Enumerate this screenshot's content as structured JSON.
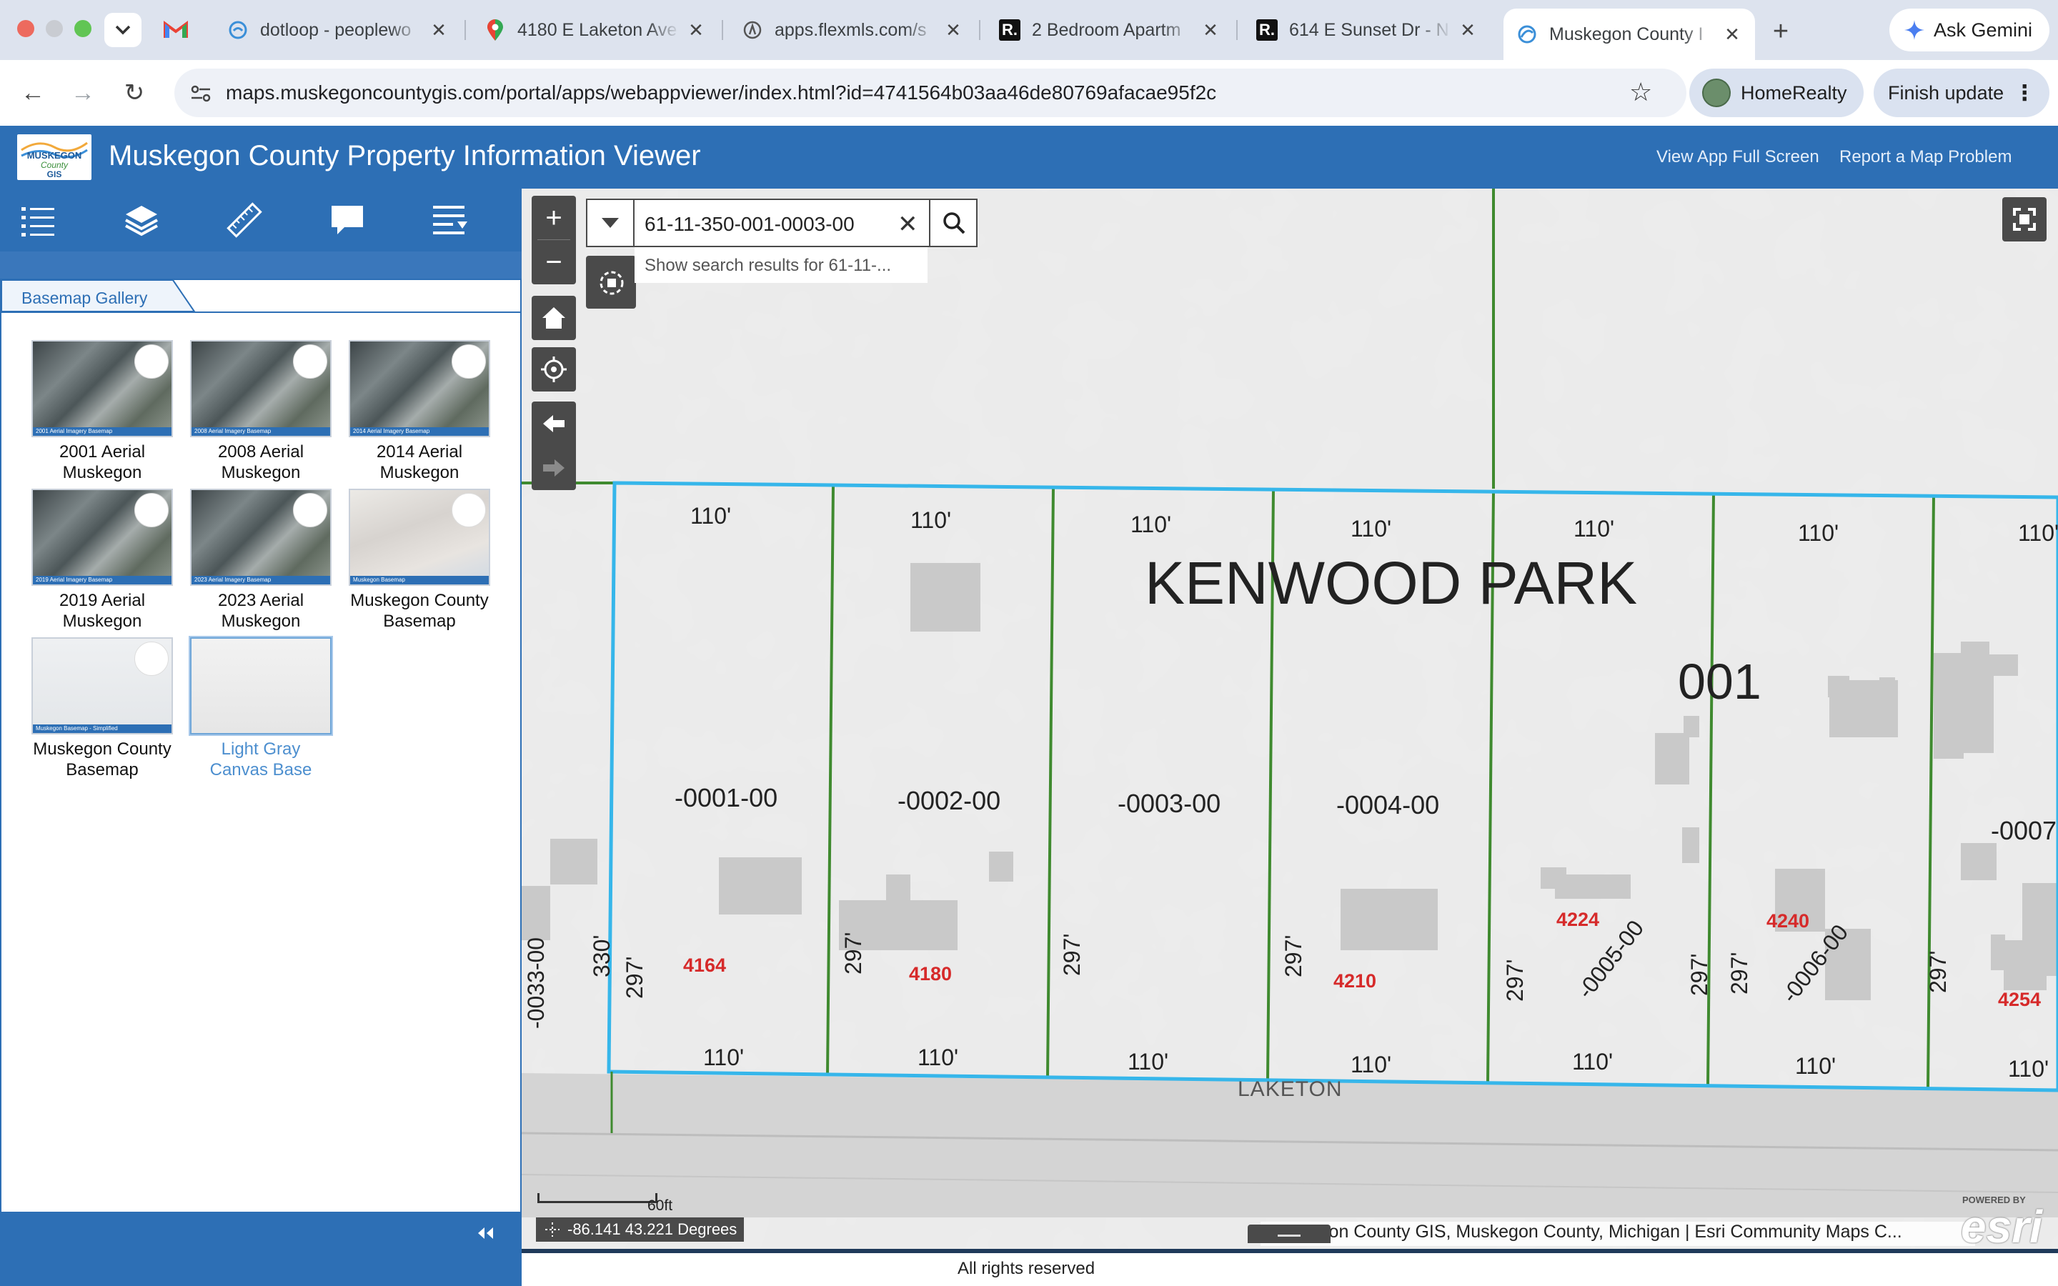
{
  "browser": {
    "tabs": [
      {
        "title": "dotloop - peoplewo",
        "icon": "dotloop-icon"
      },
      {
        "title": "4180 E Laketon Ave",
        "icon": "maps-pin-icon"
      },
      {
        "title": "apps.flexmls.com/s",
        "icon": "flexmls-icon"
      },
      {
        "title": "2 Bedroom Apartm",
        "icon": "realtor-r-icon"
      },
      {
        "title": "614 E Sunset Dr - N",
        "icon": "realtor-r-icon"
      },
      {
        "title": "Muskegon County I",
        "icon": "arcgis-icon"
      }
    ],
    "gmail_tab_icon": "gmail-icon",
    "ask_gemini": "Ask Gemini",
    "url": "maps.muskegoncountygis.com/portal/apps/webappviewer/index.html?id=4741564b03aa46de80769afacae95f2c",
    "profile_name": "HomeRealty",
    "finish_update": "Finish update"
  },
  "app": {
    "logo_lines": [
      "MUSKEGON",
      "County",
      "GIS"
    ],
    "title": "Muskegon County Property Information Viewer",
    "header_links": [
      "View App Full Screen",
      "Report a Map Problem"
    ],
    "toolbar_icons": [
      "legend-icon",
      "layers-icon",
      "measure-icon",
      "comment-icon",
      "attribute-table-icon"
    ]
  },
  "panel": {
    "tab_label": "Basemap Gallery",
    "basemaps": [
      {
        "label": "2001 Aerial Muskegon",
        "strip": "2001 Aerial Imagery Basemap",
        "kind": "aerial"
      },
      {
        "label": "2008 Aerial Muskegon",
        "strip": "2008 Aerial Imagery Basemap",
        "kind": "aerial"
      },
      {
        "label": "2014 Aerial Muskegon",
        "strip": "2014 Aerial Imagery Basemap",
        "kind": "aerial"
      },
      {
        "label": "2019 Aerial Muskegon",
        "strip": "2019 Aerial Imagery Basemap",
        "kind": "aerial"
      },
      {
        "label": "2023 Aerial Muskegon",
        "strip": "2023 Aerial Imagery Basemap",
        "kind": "aerial"
      },
      {
        "label": "Muskegon County Basemap",
        "strip": "Muskegon Basemap",
        "kind": "street"
      },
      {
        "label": "Muskegon County Basemap",
        "strip": "Muskegon Basemap - Simplified",
        "kind": "simple"
      },
      {
        "label": "Light Gray Canvas Base",
        "strip": "",
        "kind": "gray",
        "selected": true
      }
    ],
    "collapse_icon": "double-chevron-left-icon"
  },
  "map": {
    "search_value": "61-11-350-001-0003-00",
    "suggestion": "Show search results for 61-11-...",
    "subdivision": "KENWOOD PARK",
    "block": "001",
    "street": "LAKETON",
    "frontage_top": [
      "110'",
      "110'",
      "110'",
      "110'",
      "110'",
      "110'",
      "110'"
    ],
    "frontage_bottom": [
      "110'",
      "110'",
      "110'",
      "110'",
      "110'",
      "110'",
      "110'"
    ],
    "depth_labels": [
      "330'",
      "297'",
      "297'",
      "297'",
      "297'",
      "297'",
      "297'",
      "297'",
      "297'"
    ],
    "parcel_ids": [
      "-0033-00",
      "-0001-00",
      "-0002-00",
      "-0003-00",
      "-0004-00",
      "-0005-00",
      "-0006-00",
      "-0007"
    ],
    "addresses": [
      "4164",
      "4180",
      "4210",
      "4224",
      "4240",
      "4254"
    ],
    "scale_label": "60ft",
    "coordinates": "-86.141 43.221 Degrees",
    "attribution": "Muskegon County GIS, Muskegon County, Michigan | Esri Community Maps C...",
    "esri_powered": "POWERED BY",
    "esri": "esri",
    "colors": {
      "parcel_line": "#3f8a2f",
      "highlight": "#36b6ea",
      "address": "#d62a2a",
      "building": "#c9c9c9"
    }
  },
  "footer": {
    "rights": "All rights reserved"
  }
}
